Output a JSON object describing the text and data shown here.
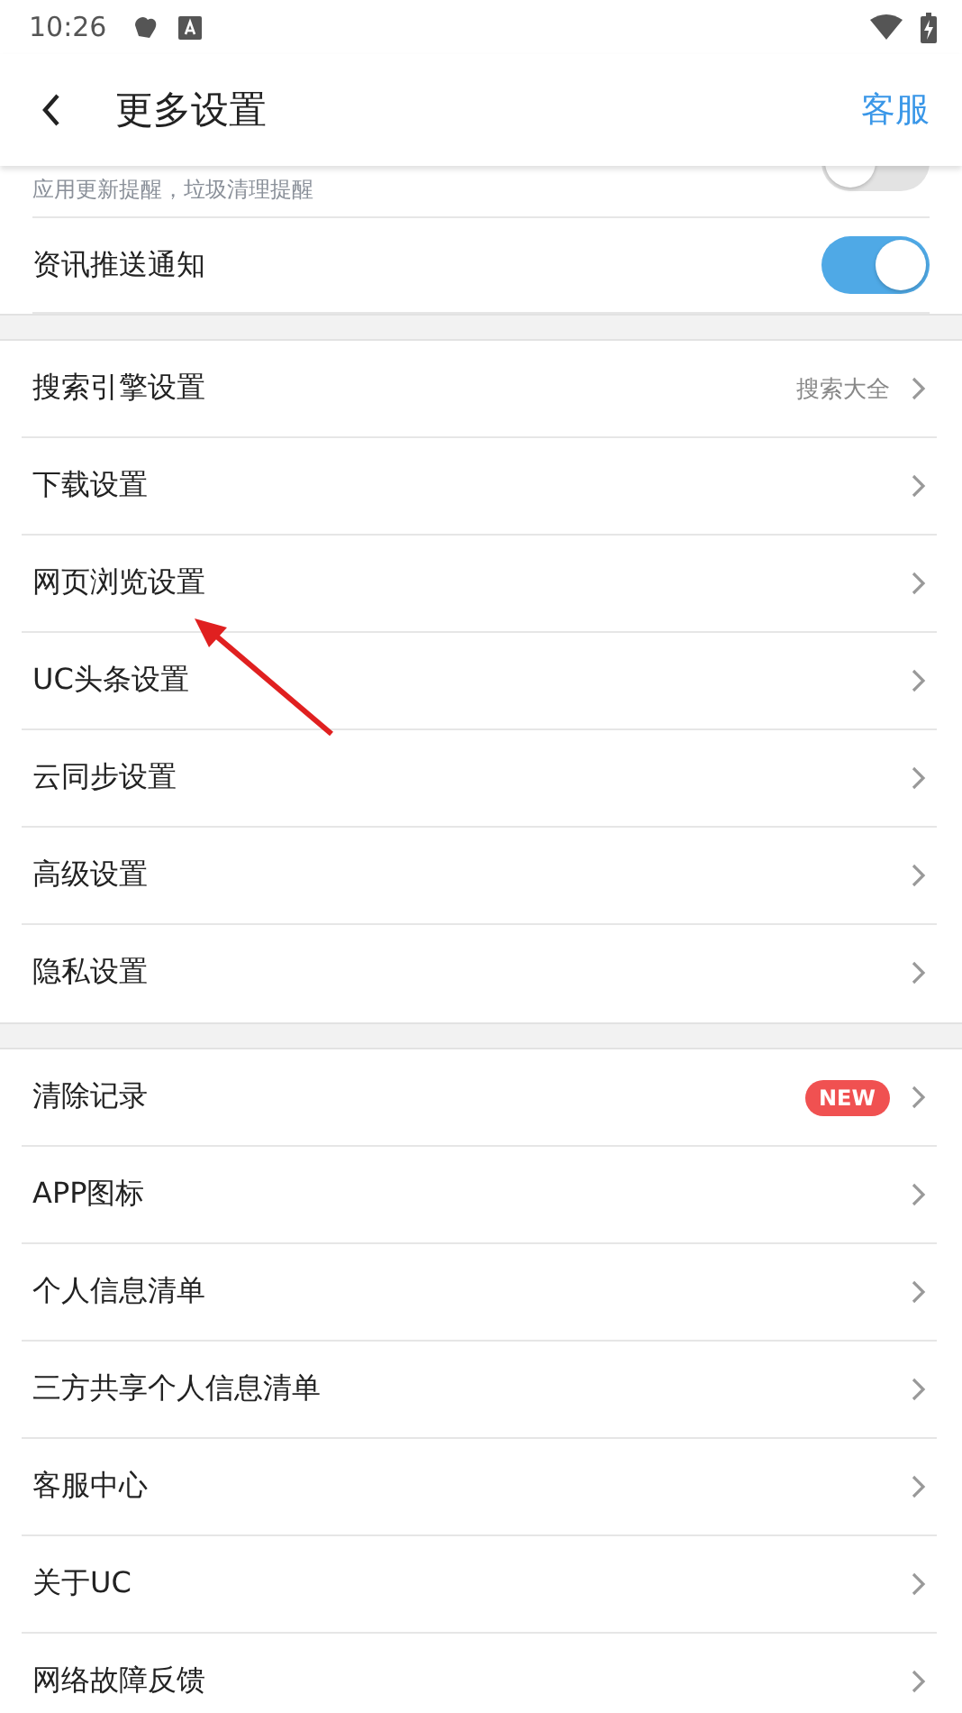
{
  "status_bar": {
    "time": "10:26"
  },
  "header": {
    "title": "更多设置",
    "action": "客服"
  },
  "toggle_rows": [
    {
      "kind": "cut",
      "subtitle": "应用更新提醒，垃圾清理提醒",
      "on": false
    },
    {
      "kind": "full",
      "label": "资讯推送通知",
      "on": true
    }
  ],
  "groups": [
    {
      "items": [
        {
          "label": "搜索引擎设置",
          "value": "搜索大全"
        },
        {
          "label": "下载设置"
        },
        {
          "label": "网页浏览设置"
        },
        {
          "label": "UC头条设置"
        },
        {
          "label": "云同步设置"
        },
        {
          "label": "高级设置"
        },
        {
          "label": "隐私设置"
        }
      ]
    },
    {
      "items": [
        {
          "label": "清除记录",
          "badge": "NEW"
        },
        {
          "label": "APP图标"
        },
        {
          "label": "个人信息清单"
        },
        {
          "label": "三方共享个人信息清单"
        },
        {
          "label": "客服中心"
        },
        {
          "label": "关于UC"
        },
        {
          "label": "网络故障反馈"
        }
      ]
    }
  ]
}
